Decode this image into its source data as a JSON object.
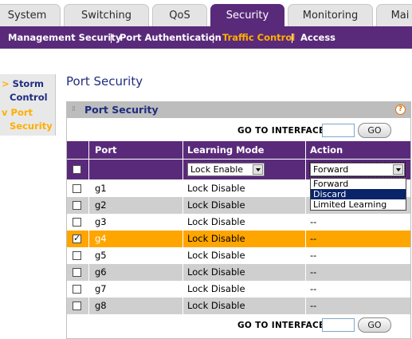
{
  "tabs": [
    {
      "label": "System",
      "active": false
    },
    {
      "label": "Switching",
      "active": false
    },
    {
      "label": "QoS",
      "active": false
    },
    {
      "label": "Security",
      "active": true
    },
    {
      "label": "Monitoring",
      "active": false
    },
    {
      "label": "Mai",
      "active": false
    }
  ],
  "subnav": [
    {
      "label": "Management Security",
      "active": false
    },
    {
      "label": "Port Authentication",
      "active": false
    },
    {
      "label": "Traffic Control",
      "active": true
    },
    {
      "label": "Access",
      "active": false
    }
  ],
  "leftmenu": [
    {
      "arrow": ">",
      "line1": "Storm",
      "line2": "Control",
      "active": false
    },
    {
      "arrow": "v",
      "line1": "Port",
      "line2": "Security",
      "active": true
    }
  ],
  "page_title": "Port Security",
  "panel": {
    "title": "Port Security",
    "help_label": "?",
    "goto_label": "GO TO INTERFACE",
    "goto_value": "",
    "go_button": "GO"
  },
  "table": {
    "columns": [
      "Port",
      "Learning Mode",
      "Action"
    ],
    "edit_row": {
      "checked": false,
      "learning_mode": "Lock Enable",
      "action": "Forward"
    },
    "action_options": [
      {
        "label": "Forward",
        "highlighted": false
      },
      {
        "label": "Discard",
        "highlighted": true
      },
      {
        "label": "Limited Learning",
        "highlighted": false
      }
    ],
    "rows": [
      {
        "port": "g1",
        "mode": "Lock Disable",
        "action": "",
        "checked": false
      },
      {
        "port": "g2",
        "mode": "Lock Disable",
        "action": "",
        "checked": false
      },
      {
        "port": "g3",
        "mode": "Lock Disable",
        "action": "--",
        "checked": false
      },
      {
        "port": "g4",
        "mode": "Lock Disable",
        "action": "--",
        "checked": true
      },
      {
        "port": "g5",
        "mode": "Lock Disable",
        "action": "--",
        "checked": false
      },
      {
        "port": "g6",
        "mode": "Lock Disable",
        "action": "--",
        "checked": false
      },
      {
        "port": "g7",
        "mode": "Lock Disable",
        "action": "--",
        "checked": false
      },
      {
        "port": "g8",
        "mode": "Lock Disable",
        "action": "--",
        "checked": false
      }
    ]
  },
  "colors": {
    "primary_purple": "#5a2a7a",
    "accent_orange": "#ffa500",
    "title_blue": "#1f2d80"
  }
}
